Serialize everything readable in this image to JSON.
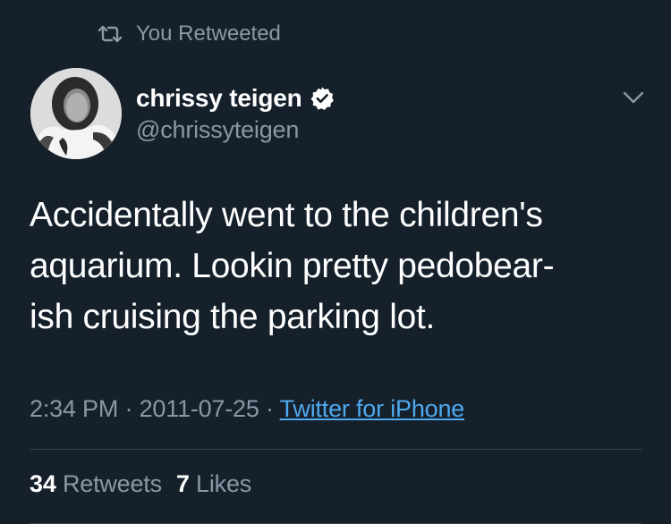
{
  "retweet_notice": {
    "icon": "retweet-icon",
    "label": "You Retweeted"
  },
  "author": {
    "display_name": "chrissy teigen",
    "handle": "@chrissyteigen",
    "verified": true,
    "verified_icon": "verified-badge-icon",
    "avatar": "profile-photo"
  },
  "menu": {
    "icon": "chevron-down-icon"
  },
  "tweet": {
    "text_lines": [
      "Accidentally went to the children's",
      "aquarium. Lookin pretty pedobear-",
      "ish cruising the parking lot."
    ],
    "time": "2:34 PM",
    "separator": " · ",
    "date": "2011-07-25",
    "source": "Twitter for iPhone"
  },
  "stats": {
    "retweets_count": "34",
    "retweets_label": "Retweets",
    "likes_count": "7",
    "likes_label": "Likes"
  },
  "colors": {
    "background": "#15202b",
    "secondary_text": "#8899a6",
    "link": "#4ea9ee",
    "divider": "#38444d"
  }
}
